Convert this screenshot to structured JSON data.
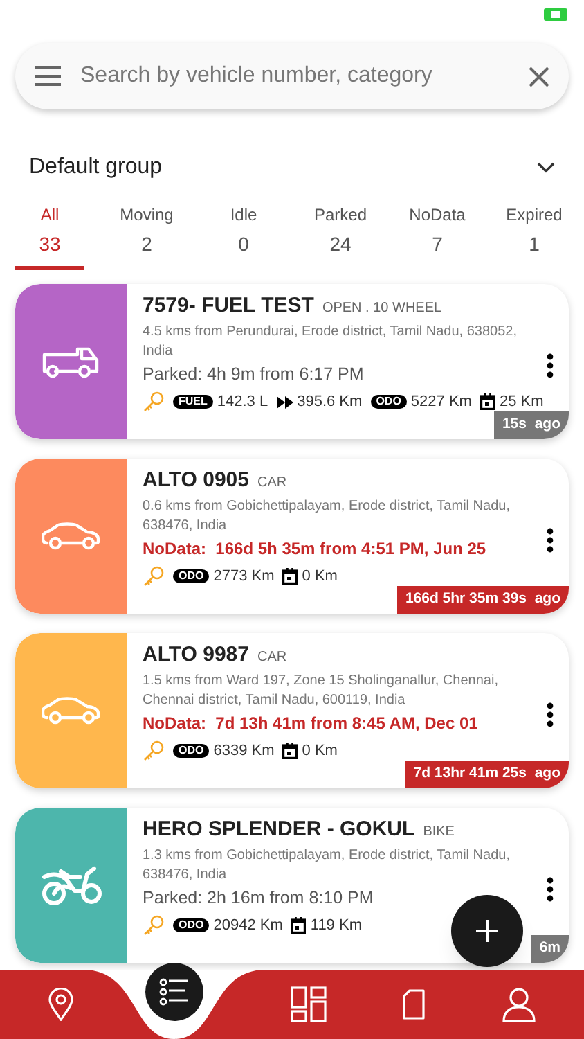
{
  "search": {
    "placeholder": "Search by vehicle number, category"
  },
  "group": {
    "label": "Default group"
  },
  "tabs": [
    {
      "label": "All",
      "count": "33",
      "selected": true
    },
    {
      "label": "Moving",
      "count": "2",
      "selected": false
    },
    {
      "label": "Idle",
      "count": "0",
      "selected": false
    },
    {
      "label": "Parked",
      "count": "24",
      "selected": false
    },
    {
      "label": "NoData",
      "count": "7",
      "selected": false
    },
    {
      "label": "Expired",
      "count": "1",
      "selected": false
    }
  ],
  "vehicles": [
    {
      "name": "7579- FUEL TEST",
      "category": "OPEN . 10 WHEEL",
      "kind": "truck",
      "color": "#b565c6",
      "address": "4.5 kms from Perundurai, Erode district, Tamil Nadu, 638052, India",
      "status": {
        "kind": "parked",
        "text": "Parked: 4h 9m from 6:17 PM"
      },
      "metrics": [
        {
          "kind": "fuel",
          "tag": "FUEL",
          "value": "142.3 L"
        },
        {
          "kind": "range",
          "value": "395.6 Km"
        },
        {
          "kind": "odo",
          "tag": "ODO",
          "value": "5227 Km"
        },
        {
          "kind": "trip",
          "value": "25 Km"
        }
      ],
      "age": "15s  ago"
    },
    {
      "name": "ALTO 0905",
      "category": "CAR",
      "kind": "car",
      "color": "#fd8a5e",
      "address": "0.6 kms from Gobichettipalayam, Erode district, Tamil Nadu, 638476, India",
      "status": {
        "kind": "nodata",
        "text": "NoData:  166d 5h 35m from 4:51 PM, Jun 25"
      },
      "metrics": [
        {
          "kind": "odo",
          "tag": "ODO",
          "value": "2773 Km"
        },
        {
          "kind": "trip",
          "value": "0 Km"
        }
      ],
      "age": "166d 5hr 35m 39s  ago"
    },
    {
      "name": "ALTO 9987",
      "category": "CAR",
      "kind": "car",
      "color": "#ffb74d",
      "address": "1.5 kms from Ward 197, Zone 15 Sholinganallur, Chennai, Chennai district, Tamil Nadu, 600119, India",
      "status": {
        "kind": "nodata",
        "text": "NoData:  7d 13h 41m from 8:45 AM, Dec 01"
      },
      "metrics": [
        {
          "kind": "odo",
          "tag": "ODO",
          "value": "6339 Km"
        },
        {
          "kind": "trip",
          "value": "0 Km"
        }
      ],
      "age": "7d 13hr 41m 25s  ago"
    },
    {
      "name": "HERO SPLENDER - GOKUL",
      "category": "BIKE",
      "kind": "bike",
      "color": "#4db6ac",
      "address": "1.3 kms from Gobichettipalayam, Erode district, Tamil Nadu, 638476, India",
      "status": {
        "kind": "parked",
        "text": "Parked: 2h 16m from 8:10 PM"
      },
      "metrics": [
        {
          "kind": "odo",
          "tag": "ODO",
          "value": "20942 Km"
        },
        {
          "kind": "trip",
          "value": "119 Km"
        }
      ],
      "age": "6m"
    }
  ]
}
